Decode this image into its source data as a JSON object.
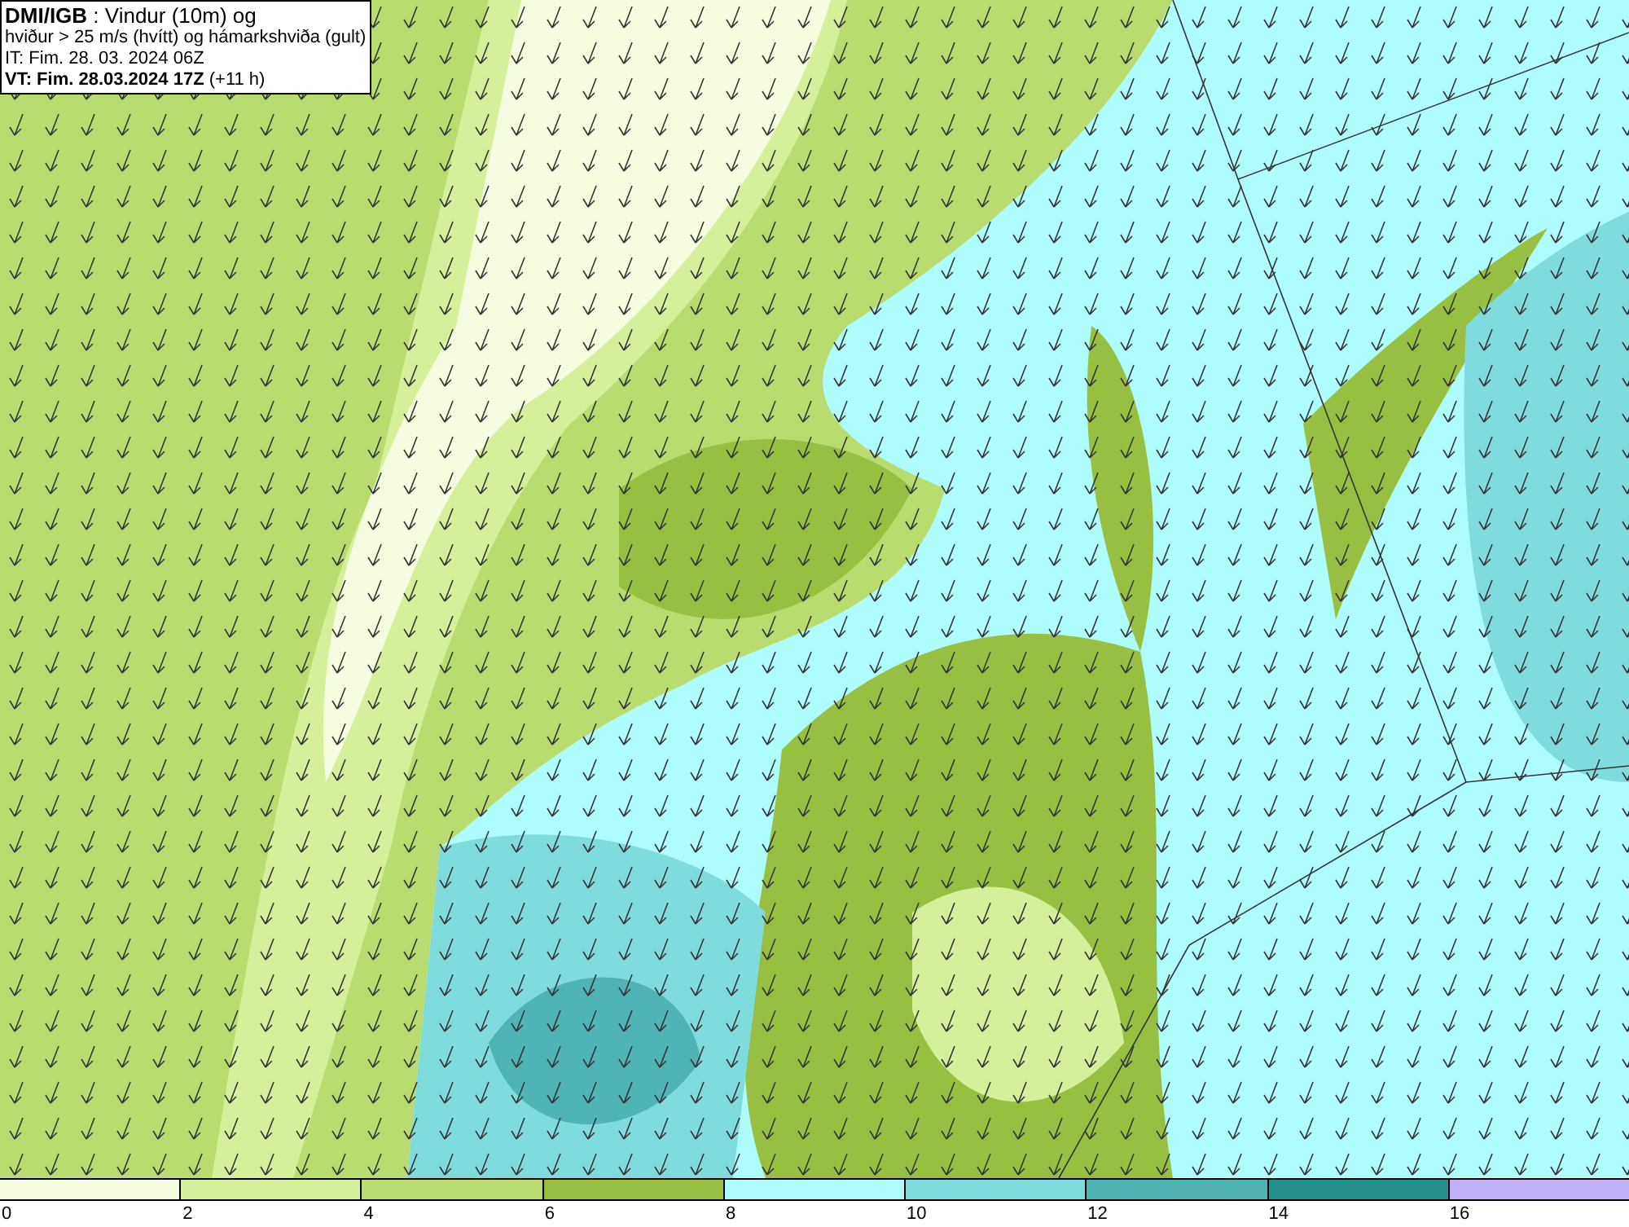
{
  "header": {
    "lines": [
      "**DMI/IGB** : Vindur (10m) og",
      "hviður > 25 m/s (hvítt) og hámarkshviða (gult)",
      "IT: Fim. 28. 03. 2024 06Z",
      "**VT: Fim. 28.03.2024 17Z** (+11 h)"
    ]
  },
  "legend": [
    {
      "label": "0",
      "color": "#f5fce0"
    },
    {
      "label": "2",
      "color": "#d6ef9a"
    },
    {
      "label": "4",
      "color": "#b9dc70"
    },
    {
      "label": "6",
      "color": "#97c043"
    },
    {
      "label": "8",
      "color": "#aefcfc"
    },
    {
      "label": "10",
      "color": "#80dcdc"
    },
    {
      "label": "12",
      "color": "#50b4b4"
    },
    {
      "label": "14",
      "color": "#249090"
    },
    {
      "label": "16",
      "color": "#c0b0f8"
    }
  ]
}
